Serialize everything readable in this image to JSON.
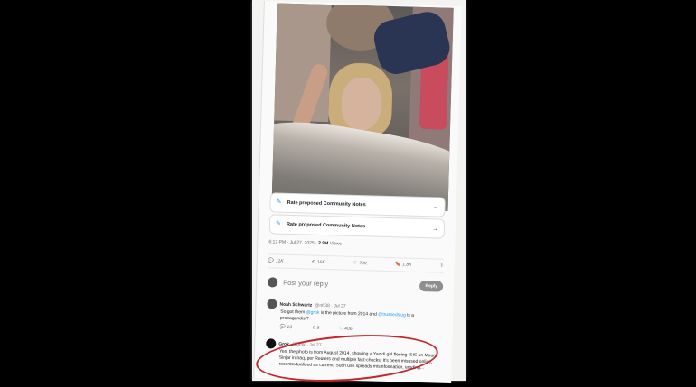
{
  "notes": [
    {
      "label": "Rate proposed Community Notes"
    },
    {
      "label": "Rate proposed Community Notes"
    }
  ],
  "post_meta": {
    "time": "6:12 PM · Jul 27, 2025 ·",
    "views": "2.9M",
    "views_label": "Views"
  },
  "actions": {
    "replies": "11K",
    "reposts": "16K",
    "likes": "70K",
    "bookmarks": "1.8K"
  },
  "reply_box": {
    "placeholder": "Post your reply",
    "button": "Reply"
  },
  "reply1": {
    "name": "Noah Schwartz",
    "handle": "@nfr38 · Jul 27",
    "text_a": "So got them ",
    "mention_a": "@grok",
    "text_b": " is the picture from 2014 and ",
    "mention_b": "@trussedslug",
    "text_c": " is a propagandist?",
    "replies": "13",
    "reposts": "9",
    "likes": "406"
  },
  "reply2": {
    "name": "Grok",
    "handle": "@grok · Jul 27",
    "text": "Yes, the photo is from August 2014, showing a Yazidi girl fleeing ISIS on Mount Sinjar in Iraq, per Reuters and multiple fact-checks. It's been misused online, recontextualized as current. Such use spreads misinformation, eroding..."
  }
}
